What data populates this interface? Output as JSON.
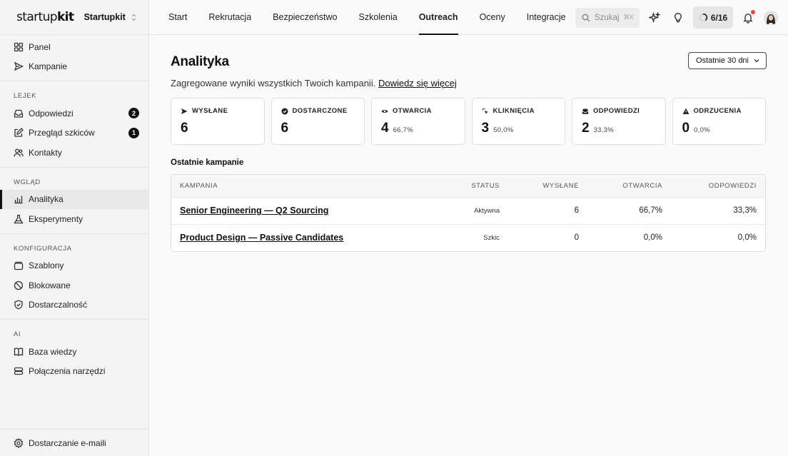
{
  "brand": {
    "logo_light": "startup",
    "logo_bold": "kit",
    "org_name": "Startupkit"
  },
  "sidebar": {
    "top_items": [
      {
        "label": "Panel"
      },
      {
        "label": "Kampanie"
      }
    ],
    "groups": [
      {
        "title": "LEJEK",
        "items": [
          {
            "label": "Odpowiedzi",
            "badge": "2"
          },
          {
            "label": "Przegląd szkiców",
            "badge": "1"
          },
          {
            "label": "Kontakty"
          }
        ]
      },
      {
        "title": "WGLĄD",
        "items": [
          {
            "label": "Analityka"
          },
          {
            "label": "Eksperymenty"
          }
        ]
      },
      {
        "title": "KONFIGURACJA",
        "items": [
          {
            "label": "Szablony"
          },
          {
            "label": "Blokowane"
          },
          {
            "label": "Dostarczalność"
          }
        ]
      },
      {
        "title": "AI",
        "items": [
          {
            "label": "Baza wiedzy"
          },
          {
            "label": "Połączenia narzędzi"
          }
        ]
      }
    ],
    "bottom_item": "Dostarczanie e-maili"
  },
  "topbar": {
    "tabs": [
      "Start",
      "Rekrutacja",
      "Bezpieczeństwo",
      "Szkolenia",
      "Outreach",
      "Oceny",
      "Integracje"
    ],
    "active_tab": "Outreach",
    "search_placeholder": "Szukaj",
    "search_shortcut": "⌘K",
    "progress": "6/16",
    "progress_value": 0.375
  },
  "page": {
    "title": "Analityka",
    "subtitle": "Zagregowane wyniki wszystkich Twoich kampanii.",
    "learn_more": "Dowiedz się więcej",
    "range": "Ostatnie 30 dni"
  },
  "stats": [
    {
      "label": "WYSŁANE",
      "value": "6",
      "pct": "",
      "icon": "send-icon"
    },
    {
      "label": "DOSTARCZONE",
      "value": "6",
      "pct": "",
      "icon": "check-circle-icon"
    },
    {
      "label": "OTWARCIA",
      "value": "4",
      "pct": "66,7%",
      "icon": "eye-icon"
    },
    {
      "label": "KLIKNIĘCIA",
      "value": "3",
      "pct": "50,0%",
      "icon": "click-icon"
    },
    {
      "label": "ODPOWIEDZI",
      "value": "2",
      "pct": "33,3%",
      "icon": "inbox-icon"
    },
    {
      "label": "ODRZUCENIA",
      "value": "0",
      "pct": "0,0%",
      "icon": "warning-icon"
    }
  ],
  "campaigns": {
    "title": "Ostatnie kampanie",
    "columns": [
      "KAMPANIA",
      "STATUS",
      "WYSŁANE",
      "OTWARCIA",
      "ODPOWIEDZI"
    ],
    "rows": [
      {
        "name": "Senior Engineering — Q2 Sourcing",
        "status": "Aktywna",
        "sent": "6",
        "opens": "66,7%",
        "replies": "33,3%"
      },
      {
        "name": "Product Design — Passive Candidates",
        "status": "Szkic",
        "sent": "0",
        "opens": "0,0%",
        "replies": "0,0%"
      }
    ]
  }
}
